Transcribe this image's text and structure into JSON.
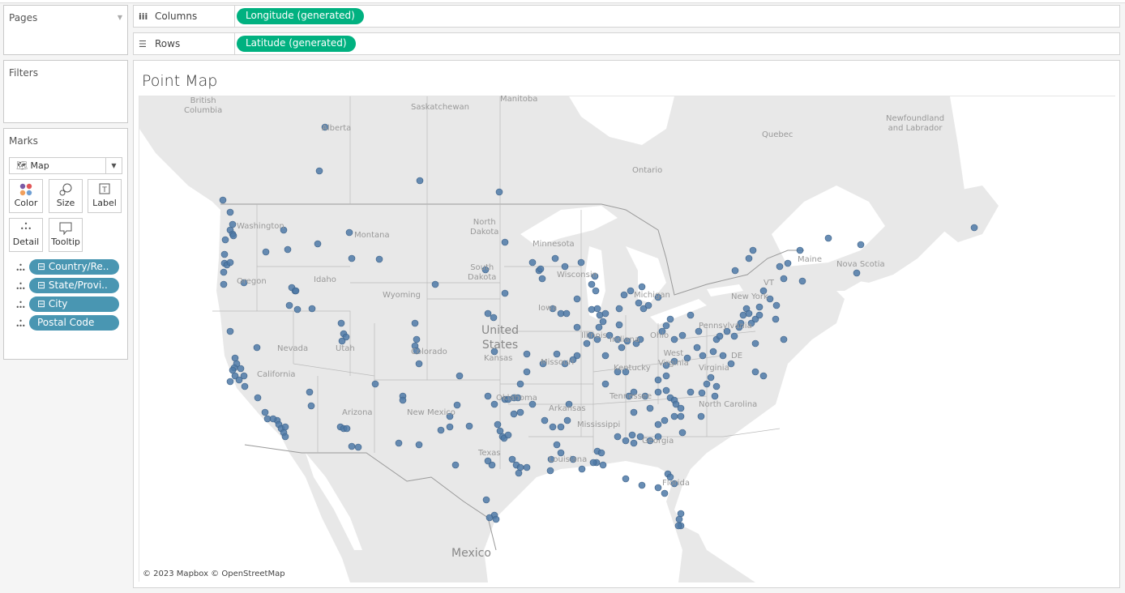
{
  "pages": {
    "title": "Pages"
  },
  "filters": {
    "title": "Filters"
  },
  "marks": {
    "title": "Marks",
    "mark_type": "Map",
    "buttons": [
      {
        "label": "Color",
        "icon": "color-dots-icon"
      },
      {
        "label": "Size",
        "icon": "size-circles-icon"
      },
      {
        "label": "Label",
        "icon": "text-label-icon"
      },
      {
        "label": "Detail",
        "icon": "detail-dots-icon"
      },
      {
        "label": "Tooltip",
        "icon": "tooltip-bubble-icon"
      }
    ],
    "fields": [
      {
        "label": "Country/Re..",
        "collapsible": true
      },
      {
        "label": "State/Provi..",
        "collapsible": true
      },
      {
        "label": "City",
        "collapsible": true
      },
      {
        "label": "Postal Code",
        "collapsible": false
      }
    ]
  },
  "shelves": {
    "columns": {
      "label": "Columns",
      "pill": "Longitude (generated)"
    },
    "rows": {
      "label": "Rows",
      "pill": "Latitude (generated)"
    }
  },
  "viz": {
    "title": "Point Map",
    "credit": "© 2023 Mapbox © OpenStreetMap",
    "labels": [
      "British Columbia",
      "Alberta",
      "Saskatchewan",
      "Manitoba",
      "Ontario",
      "Quebec",
      "Newfoundland and Labrador",
      "Nova Scotia",
      "Maine",
      "Washington",
      "Oregon",
      "Idaho",
      "Montana",
      "North Dakota",
      "South Dakota",
      "Minnesota",
      "Wyoming",
      "Nevada",
      "Utah",
      "Colorado",
      "California",
      "Arizona",
      "New Mexico",
      "Kansas",
      "Iowa",
      "Oklahoma",
      "Texas",
      "Missouri",
      "Arkansas",
      "Mississippi",
      "Louisiana",
      "Georgia",
      "Florida",
      "Illinois",
      "Indiana",
      "Ohio",
      "Kentucky",
      "Tennessee",
      "West Virginia",
      "Virginia",
      "Pennsylvania",
      "New York",
      "North Carolina",
      "Michigan",
      "Wisconsin",
      "VT",
      "DE",
      "United States",
      "Mexico"
    ]
  },
  "colors": {
    "pill_green": "#00b180",
    "pill_blue": "#4996b2",
    "mark": "#4e79a7",
    "land": "#e8e8e8",
    "water": "#ffffff"
  }
}
